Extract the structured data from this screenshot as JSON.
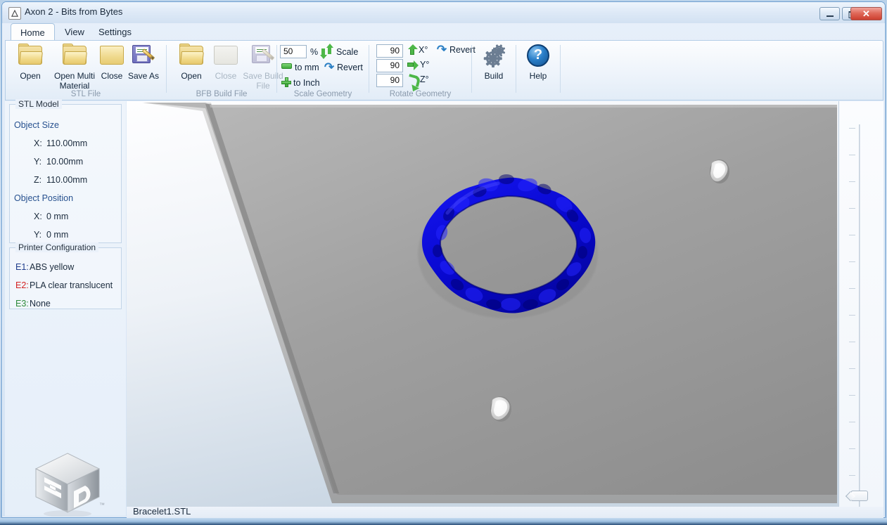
{
  "window": {
    "title": "Axon 2 - Bits from Bytes",
    "app_icon": "axon-logo-icon",
    "controls": {
      "minimize": "minimize-icon",
      "maximize": "maximize-icon",
      "close": "✕"
    }
  },
  "tabs": [
    {
      "label": "Home",
      "active": true
    },
    {
      "label": "View",
      "active": false
    },
    {
      "label": "Settings",
      "active": false
    }
  ],
  "ribbon": {
    "groups": [
      {
        "label": "STL File",
        "buttons": [
          {
            "label": "Open",
            "icon": "open-folder-icon",
            "disabled": false
          },
          {
            "label": "Open Multi Material",
            "icon": "open-folder-icon",
            "disabled": false
          },
          {
            "label": "Close",
            "icon": "closed-folder-icon",
            "disabled": false
          },
          {
            "label": "Save As",
            "icon": "save-disk-icon",
            "disabled": false
          }
        ]
      },
      {
        "label": "BFB Build File",
        "buttons": [
          {
            "label": "Open",
            "icon": "open-folder-icon",
            "disabled": false
          },
          {
            "label": "Close",
            "icon": "closed-folder-icon",
            "disabled": true
          },
          {
            "label": "Save Build File",
            "icon": "save-disk-icon",
            "disabled": true
          }
        ]
      },
      {
        "label": "Scale Geometry",
        "scale_value": "50",
        "percent_symbol": "%",
        "scale_label": "Scale",
        "to_mm_label": "to mm",
        "revert_label": "Revert",
        "to_inch_label": "to Inch"
      },
      {
        "label": "Rotate Geometry",
        "axes": [
          {
            "value": "90",
            "label": "X°",
            "icon": "arrow-up-green-icon"
          },
          {
            "value": "90",
            "label": "Y°",
            "icon": "arrow-right-green-icon"
          },
          {
            "value": "90",
            "label": "Z°",
            "icon": "arrow-curve-green-icon"
          }
        ],
        "revert_label": "Revert"
      },
      {
        "label": "",
        "buttons": [
          {
            "label": "Build",
            "icon": "gears-icon",
            "disabled": false
          },
          {
            "label": "Help",
            "icon": "help-question-icon",
            "disabled": false
          }
        ]
      }
    ]
  },
  "sidebar": {
    "model_group_title": "STL Model",
    "object_size_heading": "Object Size",
    "object_size": [
      {
        "axis": "X:",
        "value": "110.00mm"
      },
      {
        "axis": "Y:",
        "value": "10.00mm"
      },
      {
        "axis": "Z:",
        "value": "110.00mm"
      }
    ],
    "object_position_heading": "Object Position",
    "object_position": [
      {
        "axis": "X:",
        "value": "0 mm"
      },
      {
        "axis": "Y:",
        "value": "0 mm"
      }
    ],
    "printer_group_title": "Printer Configuration",
    "extruders": [
      {
        "key": "E1:",
        "value": "ABS yellow",
        "color": "#1f3d8c"
      },
      {
        "key": "E2:",
        "value": "PLA clear translucent",
        "color": "#d42222"
      },
      {
        "key": "E3:",
        "value": "None",
        "color": "#2e8b3a"
      }
    ],
    "logo_trademark": "™"
  },
  "viewport": {
    "platform_color": "#9a9a9a",
    "model_color": "#0a0ad2",
    "model_name": "bracelet-torus"
  },
  "statusbar": {
    "filename": "Bracelet1.STL"
  },
  "ruler": {
    "name": "zoom-slider"
  },
  "colors": {
    "accent": "#2b7fc4",
    "window_chrome": "#d4e3f4",
    "ribbon_bg": "#eef4fb",
    "green": "#4db748",
    "close_red": "#cc3f2f"
  }
}
